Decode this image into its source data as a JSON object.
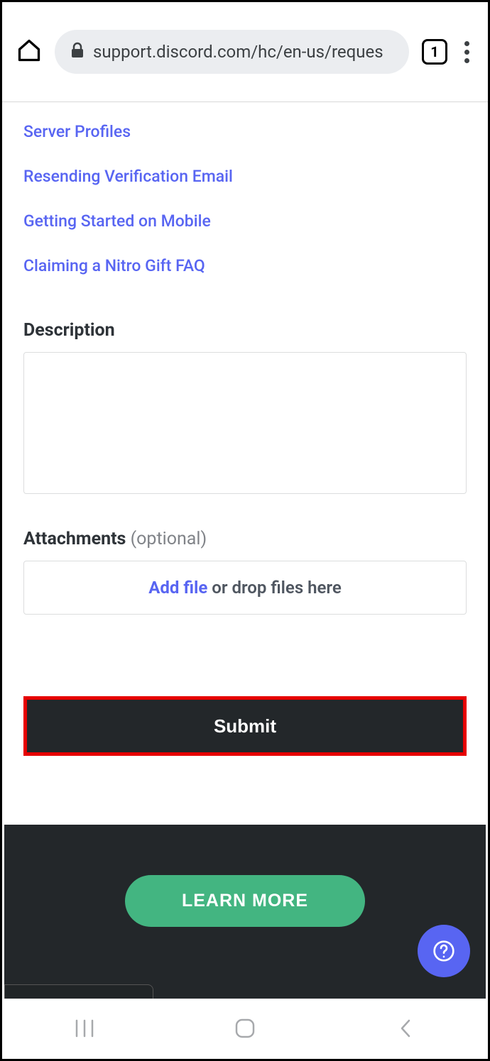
{
  "browser": {
    "url": "support.discord.com/hc/en-us/reques",
    "tab_count": "1"
  },
  "links": [
    "Server Profiles",
    "Resending Verification Email",
    "Getting Started on Mobile",
    "Claiming a Nitro Gift FAQ"
  ],
  "form": {
    "description_label": "Description",
    "attachments_label": "Attachments",
    "attachments_optional": "(optional)",
    "add_file": "Add file",
    "drop_text": "or drop files here",
    "submit_label": "Submit"
  },
  "footer": {
    "learn_more": "LEARN MORE"
  }
}
